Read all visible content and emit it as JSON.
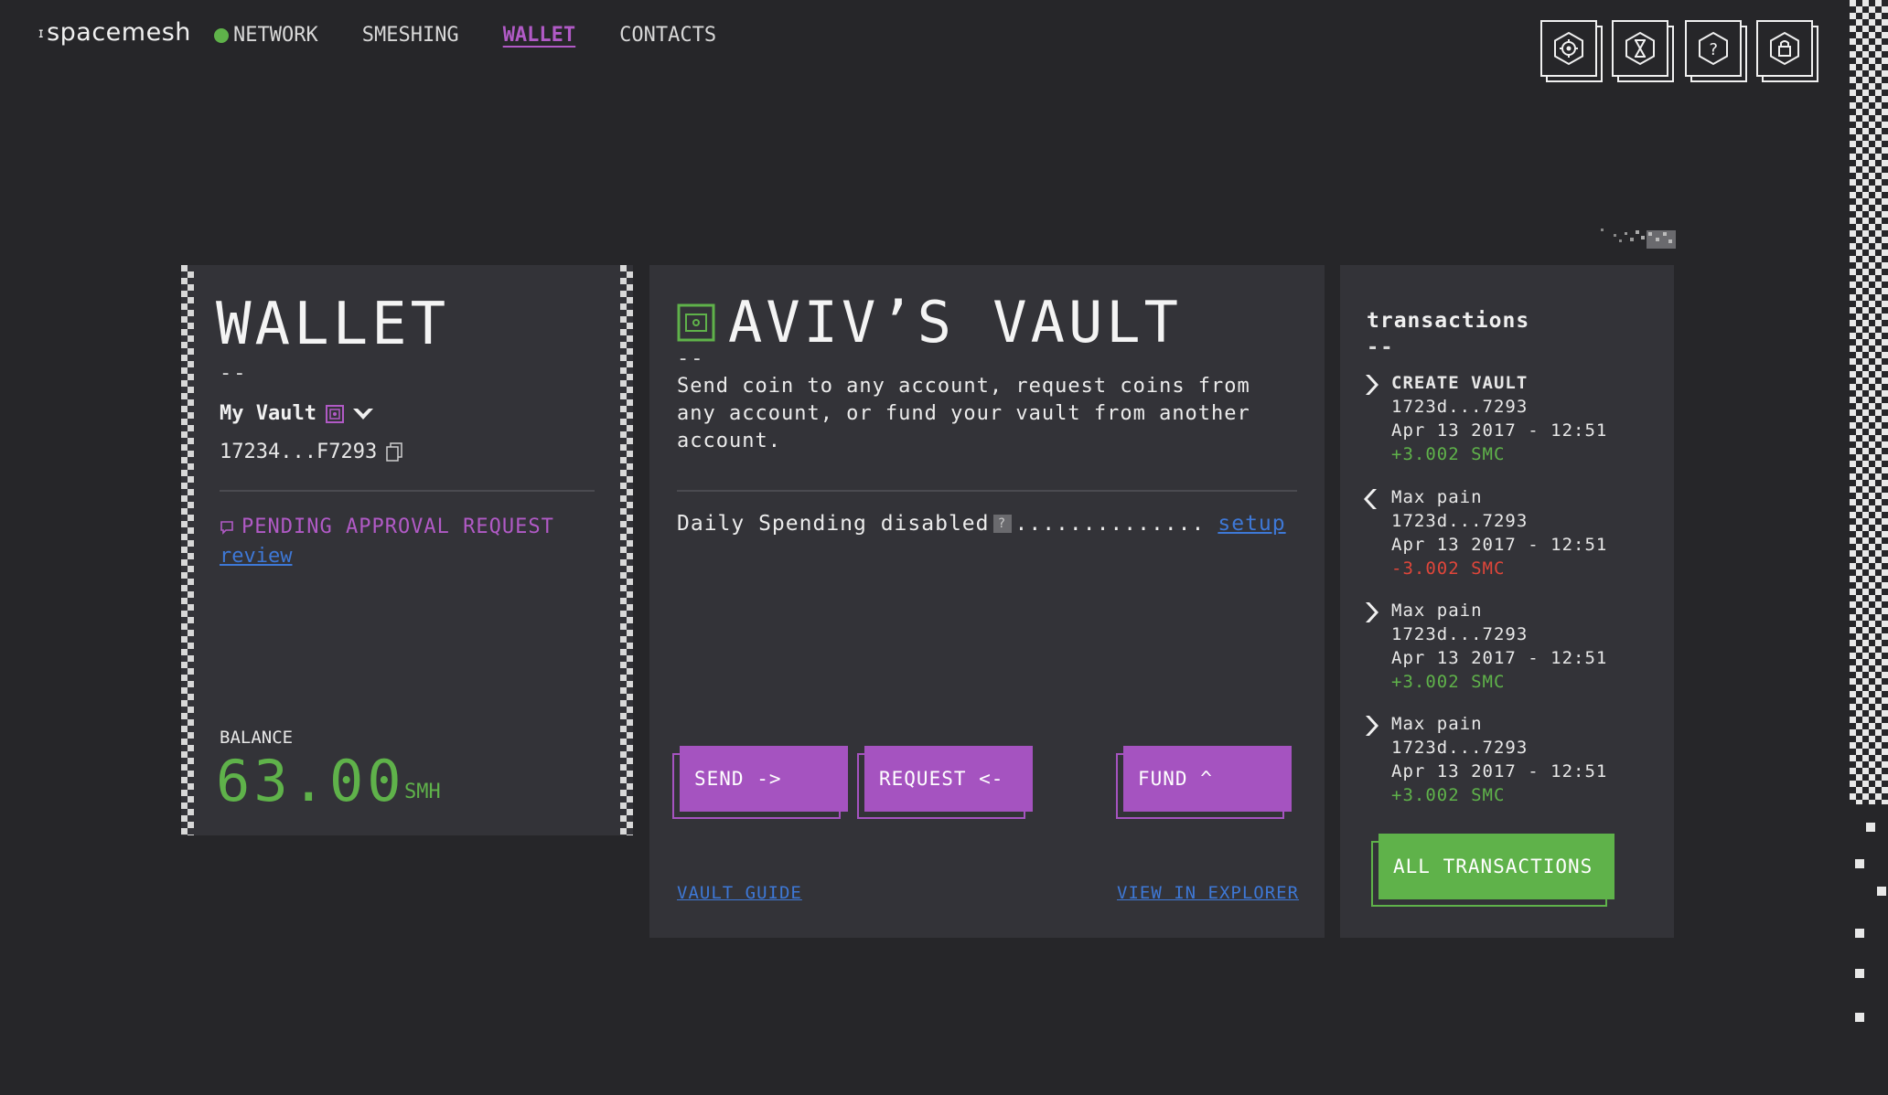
{
  "app": {
    "logo_mark": "ɪ",
    "logo_text": "spacemesh"
  },
  "nav": {
    "items": [
      {
        "label": "NETWORK",
        "status": "online"
      },
      {
        "label": "SMESHING"
      },
      {
        "label": "WALLET",
        "active": true
      },
      {
        "label": "CONTACTS"
      }
    ]
  },
  "top_icons": [
    "settings-icon",
    "hourglass-icon",
    "help-icon",
    "lock-icon"
  ],
  "wallet": {
    "title": "WALLET",
    "dashes": "--",
    "account_name": "My Vault",
    "address": "17234...F7293",
    "pending_text": "PENDING APPROVAL REQUEST",
    "review_link": "review",
    "balance_label": "BALANCE",
    "balance_value": "63.00",
    "balance_unit": "SMH"
  },
  "vault": {
    "title": "AVIV’S VAULT",
    "dashes": "--",
    "description": "Send coin to any account, request coins from any account, or fund your vault from another account.",
    "daily_spending": "Daily Spending disabled",
    "info_glyph": "?",
    "dots": "..............",
    "setup_link": "setup",
    "buttons": {
      "send": "SEND ->",
      "request": "REQUEST <-",
      "fund": "FUND ^"
    },
    "guide_link": "VAULT GUIDE",
    "explorer_link": "VIEW IN EXPLORER"
  },
  "transactions": {
    "title": "transactions",
    "dashes": "--",
    "items": [
      {
        "name": "CREATE VAULT",
        "address": "1723d...7293",
        "date": "Apr 13 2017 - 12:51",
        "amount": "+3.002 SMC",
        "direction": "out"
      },
      {
        "name": "Max pain",
        "address": "1723d...7293",
        "date": "Apr 13 2017 - 12:51",
        "amount": "-3.002 SMC",
        "direction": "in"
      },
      {
        "name": "Max pain",
        "address": "1723d...7293",
        "date": "Apr 13 2017 - 12:51",
        "amount": "+3.002 SMC",
        "direction": "out"
      },
      {
        "name": "Max pain",
        "address": "1723d...7293",
        "date": "Apr 13 2017 - 12:51",
        "amount": "+3.002 SMC",
        "direction": "out"
      }
    ],
    "all_button": "ALL TRANSACTIONS"
  },
  "colors": {
    "background": "#262629",
    "panel": "#333338",
    "accent_purple": "#a553c0",
    "accent_green": "#5fb24a",
    "link_blue": "#3e78d6",
    "negative_red": "#e0463a"
  }
}
